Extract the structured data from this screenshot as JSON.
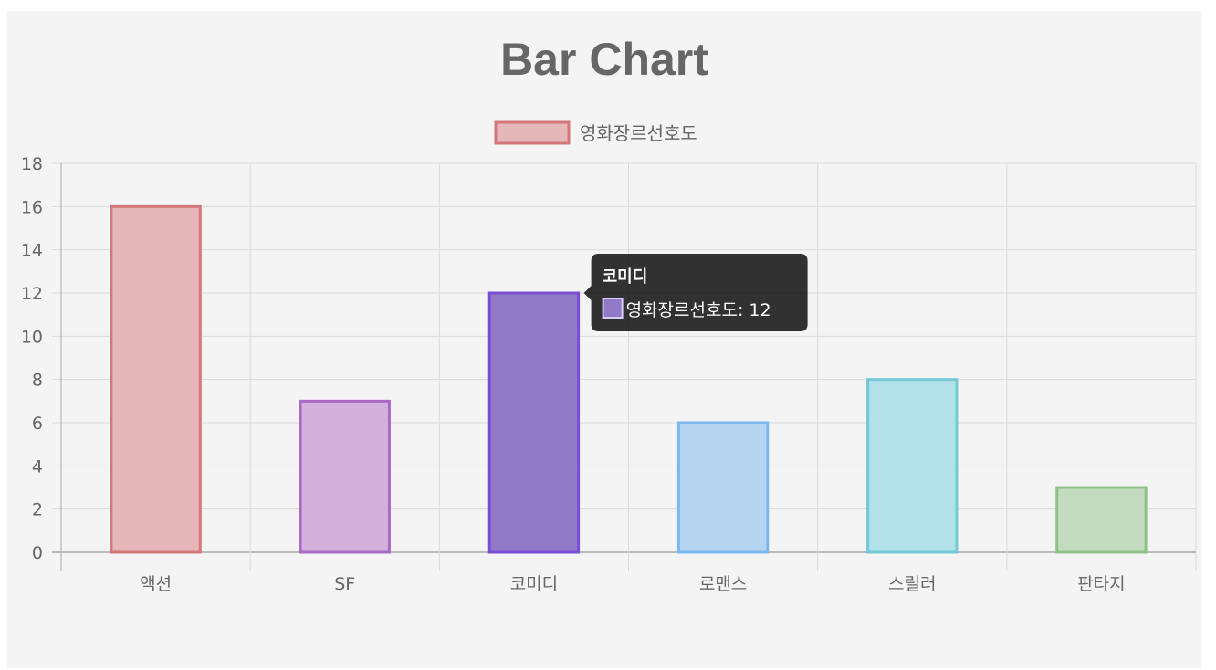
{
  "chart_data": {
    "type": "bar",
    "title": "Bar Chart",
    "categories": [
      "액션",
      "SF",
      "코미디",
      "로맨스",
      "스릴러",
      "판타지"
    ],
    "series": [
      {
        "name": "영화장르선호도",
        "values": [
          16,
          7,
          12,
          6,
          8,
          3
        ]
      }
    ],
    "ylim": [
      0,
      18
    ],
    "yticks": [
      0,
      2,
      4,
      6,
      8,
      10,
      12,
      14,
      16,
      18
    ],
    "grid": true,
    "legend": "top-center",
    "colors": {
      "fill": [
        "#e6b7b8",
        "#d4b0dc",
        "#9279c7",
        "#b5d4f0",
        "#b3e1ea",
        "#c3dcc0"
      ],
      "stroke": [
        "#d3777a",
        "#a969c5",
        "#7a4fd4",
        "#7db7ef",
        "#74c9d9",
        "#8fc088"
      ],
      "legend_fill": "#e6b7b8",
      "legend_stroke": "#d3777a"
    },
    "tooltip": {
      "category": "코미디",
      "label": "영화장르선호도: 12",
      "color_fill": "#9279c7",
      "color_stroke": "#d9ccf3"
    }
  }
}
